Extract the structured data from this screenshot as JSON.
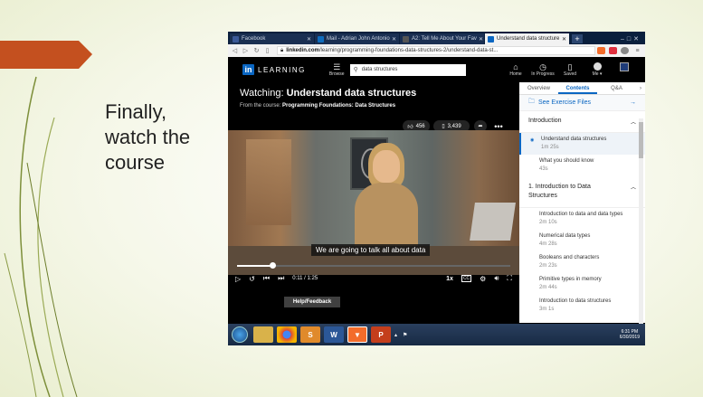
{
  "slide": {
    "text": "Finally, watch the course"
  },
  "browser": {
    "tabs": [
      {
        "label": "Facebook",
        "color": "#3b5998"
      },
      {
        "label": "Mail - Adrian John Antonio",
        "color": "#0f6cbd"
      },
      {
        "label": "A2: Tell Me About Your Fav",
        "color": "#555555"
      },
      {
        "label": "Understand data structure",
        "color": "#0a66c2",
        "active": true
      }
    ],
    "url_prefix": "linkedin.com",
    "url_rest": "/learning/programming-foundations-data-structures-2/understand-data-st..."
  },
  "header": {
    "logo_text": "LEARNING",
    "browse_label": "Browse",
    "search_value": "data structures",
    "nav": [
      {
        "label": "Home",
        "icon": "⌂"
      },
      {
        "label": "In Progress",
        "icon": "◷"
      },
      {
        "label": "Saved",
        "icon": "▯"
      },
      {
        "label": "Me ▾",
        "icon": "avatar"
      }
    ]
  },
  "player": {
    "watching_prefix": "Watching:",
    "watching_title": "Understand data structures",
    "from_prefix": "From the course:",
    "from_course": "Programming Foundations: Data Structures",
    "likes": "456",
    "saves": "3,439",
    "caption": "We are going to talk all about data",
    "time": "0:11 / 1:25",
    "progress": 0.13,
    "speed": "1x",
    "cc": "CC"
  },
  "sidebar": {
    "tabs": [
      "Overview",
      "Contents",
      "Q&A"
    ],
    "active_tab": "Contents",
    "exercise_files": "See Exercise Files",
    "intro_section": "Introduction",
    "intro_items": [
      {
        "title": "Understand data structures",
        "dur": "1m 25s"
      },
      {
        "title": "What you should know",
        "dur": "43s"
      }
    ],
    "section1": "1. Introduction to Data Structures",
    "section1_items": [
      {
        "title": "Introduction to data and data types",
        "dur": "2m 10s"
      },
      {
        "title": "Numerical data types",
        "dur": "4m 28s"
      },
      {
        "title": "Booleans and characters",
        "dur": "2m 23s"
      },
      {
        "title": "Primitive types in memory",
        "dur": "2m 44s"
      },
      {
        "title": "Introduction to data structures",
        "dur": "3m 1s"
      }
    ],
    "help": "Help/Feedback"
  },
  "taskbar": {
    "time": "6:31 PM",
    "date": "6/30/2019"
  }
}
